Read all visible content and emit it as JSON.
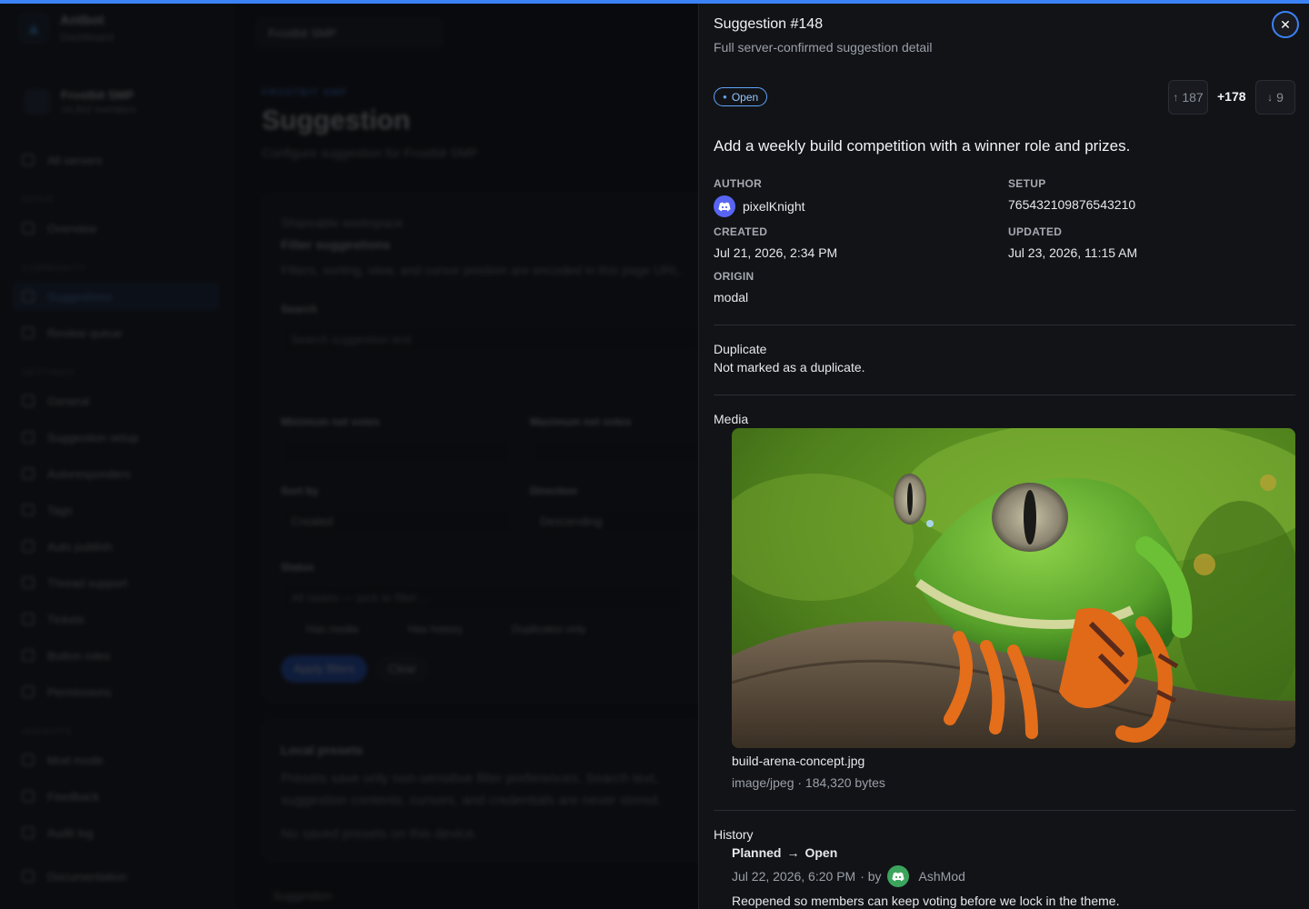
{
  "app": {
    "name": "Antbot",
    "subtitle": "Dashboard"
  },
  "server_card": {
    "name": "Frostbit SMP",
    "members": "14,302 members"
  },
  "sidebar": {
    "all_servers": "All servers",
    "sections": [
      {
        "title": "GUILD",
        "items": [
          "Overview"
        ]
      },
      {
        "title": "COMMUNITY",
        "items": [
          "Suggestions",
          "Review queue"
        ]
      },
      {
        "title": "SETTINGS",
        "items": [
          "General",
          "Suggestion setup",
          "Autoresponders",
          "Tags",
          "Auto publish",
          "Thread support",
          "Tickets",
          "Button roles",
          "Permissions"
        ]
      },
      {
        "title": "INSIGHTS",
        "items": [
          "Mod mode",
          "Feedback",
          "Audit log"
        ]
      }
    ],
    "footer_item": "Documentation",
    "active": "Suggestions"
  },
  "main": {
    "server_select": "Frostbit SMP",
    "eyebrow": "FROSTBIT SMP",
    "title": "Suggestion",
    "subtitle": "Configure suggestion for Frostbit SMP",
    "filter_card": {
      "kicker": "Shareable workspace",
      "title": "Filter suggestions",
      "desc": "Filters, sorting, view, and cursor position are encoded in this page URL.",
      "search_label": "Search",
      "search_placeholder": "Search suggestion text",
      "min_votes_label": "Minimum net votes",
      "max_votes_label": "Maximum net votes",
      "sort_label": "Sort by",
      "sort_value": "Created",
      "direction_label": "Direction",
      "direction_value": "Descending",
      "status_label": "Status",
      "status_placeholder": "All states — pick to filter…",
      "checks": [
        "Has media",
        "Has history",
        "Duplicates only"
      ],
      "apply": "Apply filters",
      "clear": "Clear"
    },
    "presets_card": {
      "title": "Local presets",
      "desc": "Presets save only non-sensitive filter preferences. Search text, suggestion contents, cursors, and credentials are never stored.",
      "empty": "No saved presets on this device."
    },
    "footer_peek": "Suggestion"
  },
  "drawer": {
    "title": "Suggestion #148",
    "subtitle": "Full server-confirmed suggestion detail",
    "status": "Open",
    "upvotes": "187",
    "net": "+178",
    "downvotes": "9",
    "content": "Add a weekly build competition with a winner role and prizes.",
    "author_label": "AUTHOR",
    "author": "pixelKnight",
    "setup_label": "SETUP",
    "setup": "765432109876543210",
    "created_label": "CREATED",
    "created": "Jul 21, 2026, 2:34 PM",
    "updated_label": "UPDATED",
    "updated": "Jul 23, 2026, 11:15 AM",
    "origin_label": "ORIGIN",
    "origin": "modal",
    "duplicate_heading": "Duplicate",
    "duplicate_text": "Not marked as a duplicate.",
    "media_heading": "Media",
    "media_filename": "build-arena-concept.jpg",
    "media_meta": "image/jpeg · 184,320 bytes",
    "history_heading": "History",
    "history": [
      {
        "from": "Planned",
        "arrow": "→",
        "to": "Open",
        "time": "Jul 22, 2026, 6:20 PM",
        "by": "· by",
        "actor": "AshMod",
        "note": "Reopened so members can keep voting before we lock in the theme."
      }
    ]
  },
  "colors": {
    "accent": "#3b82f6",
    "discord_blurple": "#5865f2",
    "discord_green": "#3ba55d",
    "panel": "#121317"
  },
  "icons": [
    "logo-icon",
    "close-icon",
    "discord-icon",
    "up-arrow-icon",
    "down-arrow-icon",
    "chevron-down-icon"
  ]
}
